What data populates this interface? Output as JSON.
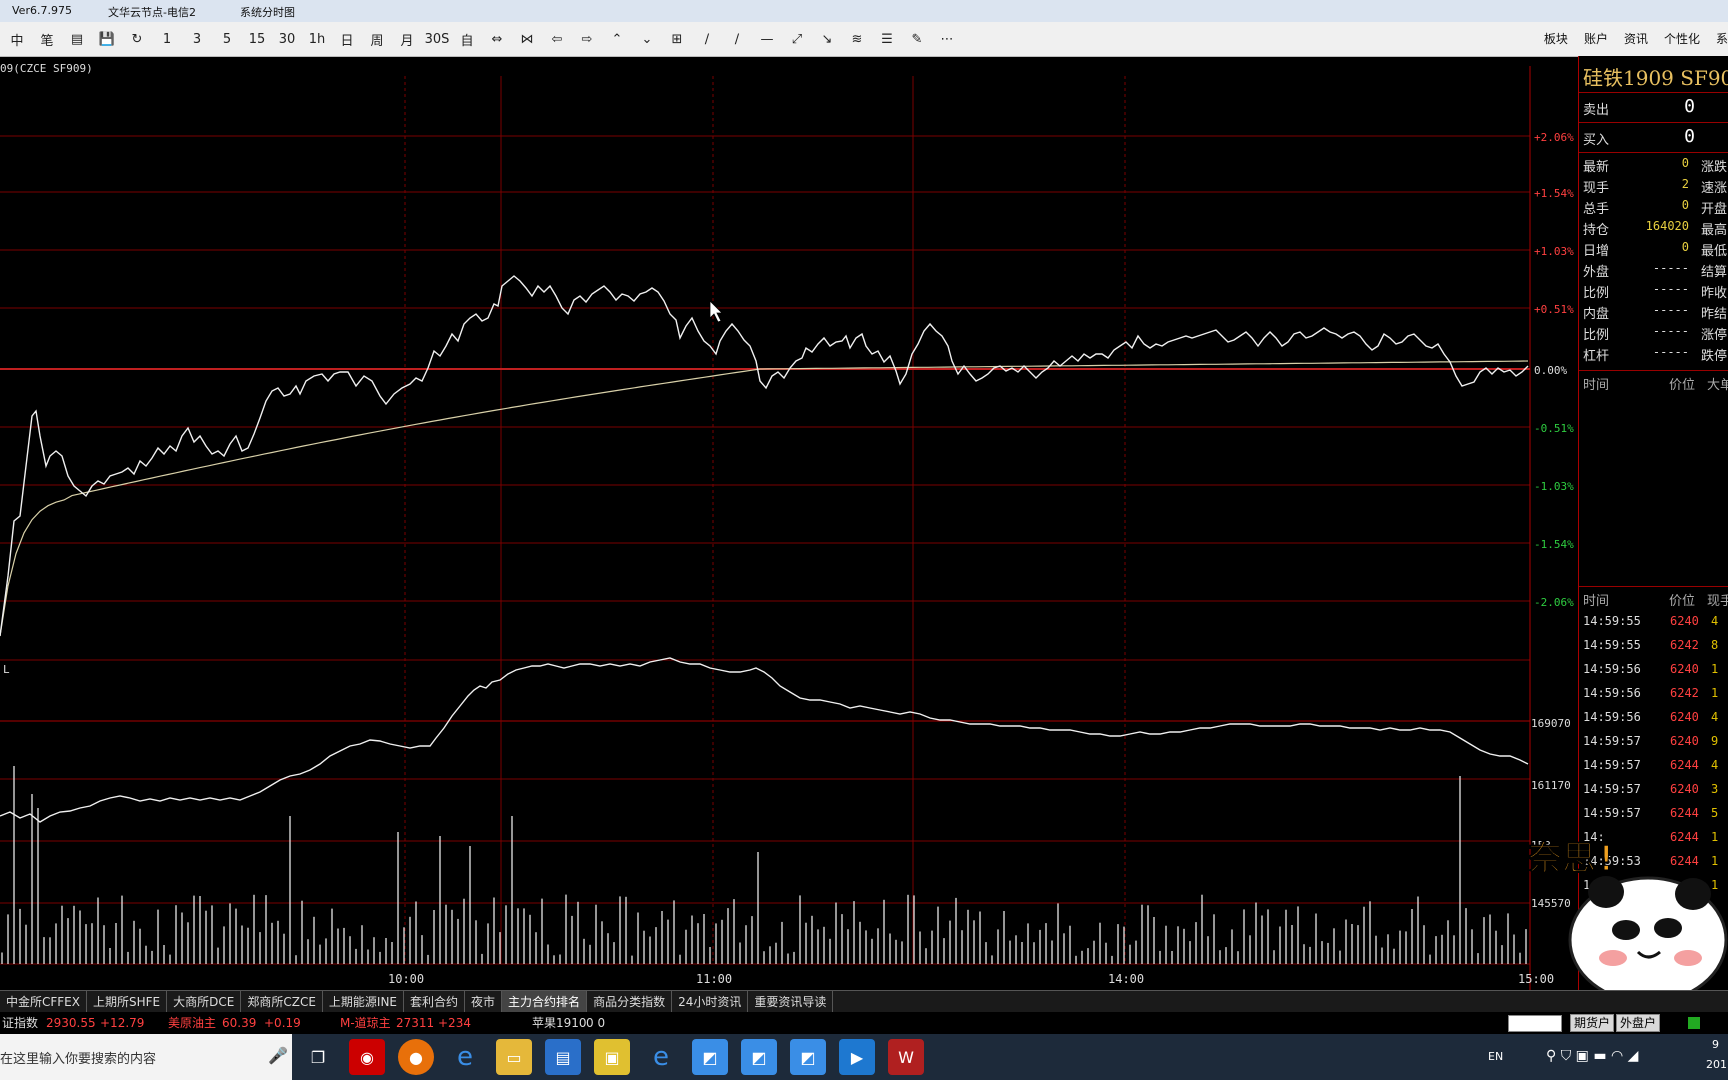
{
  "titlebar": {
    "version": "Ver6.7.975",
    "node": "文华云节点-电信2",
    "view": "系统分时图"
  },
  "toolbar": {
    "icons": [
      "中",
      "笔",
      "▤",
      "💾",
      "↻",
      "1",
      "3",
      "5",
      "15",
      "30",
      "1h",
      "日",
      "周",
      "月",
      "30S",
      "自",
      "⇔",
      "⋈",
      "⇦",
      "⇨",
      "⌃",
      "⌄",
      "⊞",
      "∕",
      "∕",
      "—",
      "⤢",
      "↘",
      "≋",
      "☰",
      "✎",
      "⋯"
    ],
    "menu": [
      "板块",
      "账户",
      "资讯",
      "个性化",
      "系"
    ]
  },
  "chart": {
    "symbol_label": "09(CZCE SF909)",
    "pct_labels": [
      "+2.06%",
      "+1.54%",
      "+1.03%",
      "+0.51%",
      "0.00%",
      "-0.51%",
      "-1.03%",
      "-1.54%",
      "-2.06%"
    ],
    "vol_label": "L",
    "oi_labels": [
      "169070",
      "161170",
      "153",
      "145570"
    ],
    "time_labels": [
      "10:00",
      "11:00",
      "14:00",
      "15:00"
    ]
  },
  "panel": {
    "title": "硅铁1909  SF90",
    "sell_label": "卖出",
    "sell_value": "0",
    "buy_label": "买入",
    "buy_value": "0",
    "rows": [
      {
        "l": "最新",
        "v": "0",
        "r": "涨跌"
      },
      {
        "l": "现手",
        "v": "2",
        "r": "速涨"
      },
      {
        "l": "总手",
        "v": "0",
        "r": "开盘"
      },
      {
        "l": "持仓",
        "v": "164020",
        "r": "最高"
      },
      {
        "l": "日增",
        "v": "0",
        "r": "最低"
      },
      {
        "l": "外盘",
        "v": "-----",
        "r": "结算"
      },
      {
        "l": "比例",
        "v": "-----",
        "r": "昨收"
      },
      {
        "l": "内盘",
        "v": "-----",
        "r": "昨结"
      },
      {
        "l": "比例",
        "v": "-----",
        "r": "涨停"
      },
      {
        "l": "杠杆",
        "v": "-----",
        "r": "跌停"
      }
    ],
    "hdr1": {
      "time": "时间",
      "price": "价位",
      "big": "大单"
    },
    "hdr2": {
      "time": "时间",
      "price": "价位",
      "qty": "现手"
    },
    "ticks": [
      {
        "t": "14:59:55",
        "p": "6240",
        "q": "4"
      },
      {
        "t": "14:59:55",
        "p": "6242",
        "q": "8"
      },
      {
        "t": "14:59:56",
        "p": "6240",
        "q": "1"
      },
      {
        "t": "14:59:56",
        "p": "6242",
        "q": "1"
      },
      {
        "t": "14:59:56",
        "p": "6240",
        "q": "4"
      },
      {
        "t": "14:59:57",
        "p": "6240",
        "q": "9"
      },
      {
        "t": "14:59:57",
        "p": "6244",
        "q": "4"
      },
      {
        "t": "14:59:57",
        "p": "6240",
        "q": "3"
      },
      {
        "t": "14:59:57",
        "p": "6244",
        "q": "5"
      },
      {
        "t": "14:",
        "p": "6244",
        "q": "1"
      },
      {
        "t": "14:59:53",
        "p": "6244",
        "q": "1"
      },
      {
        "t": "14:59:58",
        "p": "",
        "q": "1"
      }
    ]
  },
  "tabs": [
    "中金所CFFEX",
    "上期所SHFE",
    "大商所DCE",
    "郑商所CZCE",
    "上期能源INE",
    "套利合约",
    "夜市",
    "主力合约排名",
    "商品分类指数",
    "24小时资讯",
    "重要资讯导读"
  ],
  "ticker": {
    "a_label": "证指数",
    "a_val": "2930.55",
    "a_chg": "+12.79",
    "b_label": "美原油主",
    "b_val": "60.39",
    "b_chg": "+0.19",
    "c_label": "M-道琼主",
    "c_val": "27311",
    "c_chg": "+234",
    "d_label": "苹果1910",
    "d_val": "0  0",
    "btn1": "期货户",
    "btn2": "外盘户"
  },
  "taskbar": {
    "search_placeholder": "在这里输入你要搜索的内容",
    "lang": "EN",
    "time": "9",
    "date": "201"
  },
  "sticker_text": "奈思!"
}
